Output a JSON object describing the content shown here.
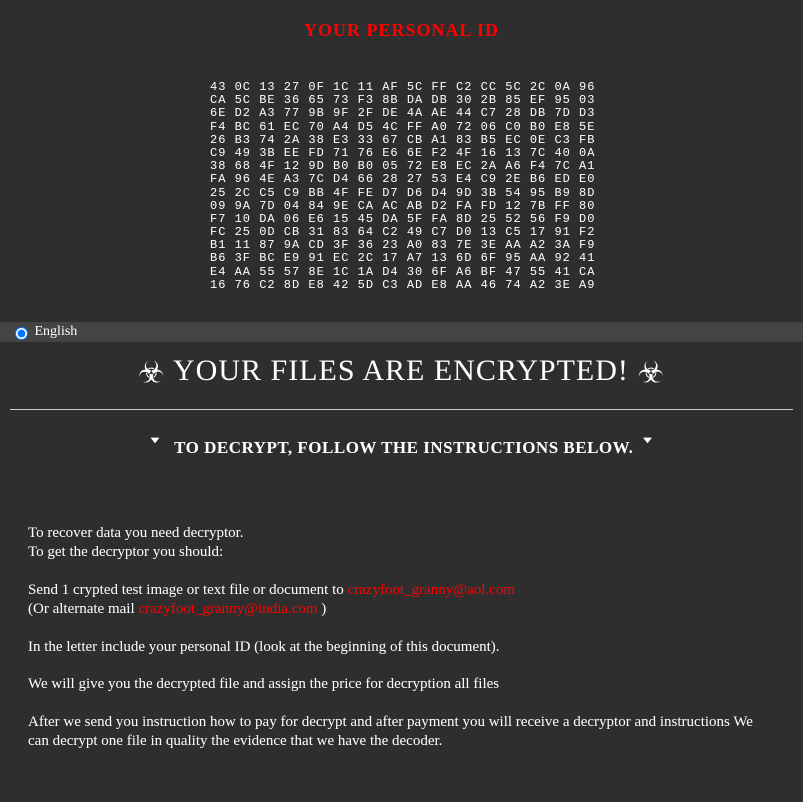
{
  "header": {
    "pid_title": "YOUR PERSONAL ID",
    "hex_lines": [
      "43 0C 13 27 0F 1C 11 AF 5C FF C2 CC 5C 2C 0A 96",
      "CA 5C BE 36 65 73 F3 8B DA DB 30 2B 85 EF 95 03",
      "6E D2 A3 77 9B 9F 2F DE 4A AE 44 C7 28 DB 7D D3",
      "F4 BC 61 EC 70 A4 D5 4C FF A0 72 06 C0 B0 E8 5E",
      "26 B3 74 2A 38 E3 33 67 CB A1 83 B5 EC 0E C3 FB",
      "C9 49 3B EE FD 71 76 E6 6E F2 4F 16 13 7C 40 0A",
      "38 68 4F 12 9D B0 B0 05 72 E8 EC 2A A6 F4 7C A1",
      "FA 96 4E A3 7C D4 66 28 27 53 E4 C9 2E B6 ED E0",
      "25 2C C5 C9 BB 4F FE D7 D6 D4 9D 3B 54 95 B9 8D",
      "09 9A 7D 04 84 9E CA AC AB D2 FA FD 12 7B FF 80",
      "F7 10 DA 06 E6 15 45 DA 5F FA 8D 25 52 56 F9 D0",
      "FC 25 0D CB 31 83 64 C2 49 C7 D0 13 C5 17 91 F2",
      "B1 11 87 9A CD 3F 36 23 A0 83 7E 3E AA A2 3A F9",
      "B6 3F BC E9 91 EC 2C 17 A7 13 6D 6F 95 AA 92 41",
      "E4 AA 55 57 8E 1C 1A D4 30 6F A6 BF 47 55 41 CA",
      "16 76 C2 8D E8 42 5D C3 AD E8 AA 46 74 A2 3E A9"
    ]
  },
  "lang": {
    "label": "English"
  },
  "main": {
    "encrypted_title": "YOUR FILES ARE ENCRYPTED!",
    "subhead": "TO DECRYPT, FOLLOW THE INSTRUCTIONS BELOW.",
    "p1a": "To recover data you need decryptor.",
    "p1b": "To get the decryptor you should:",
    "p2a": "Send 1 crypted test image or text file or document to ",
    "email1": "crazyfoot_granny@aol.com",
    "p2b": "(Or alternate mail ",
    "email2": "crazyfoot_granny@india.com",
    "p2c": " )",
    "p3": "In the letter include your personal ID (look at the beginning of this document).",
    "p4": "We will give you the decrypted file and assign the price for decryption all files",
    "p5": "After we send you instruction how to pay for decrypt and after payment you will receive a decryptor and instructions We can decrypt one file in quality the evidence that we have the decoder."
  }
}
